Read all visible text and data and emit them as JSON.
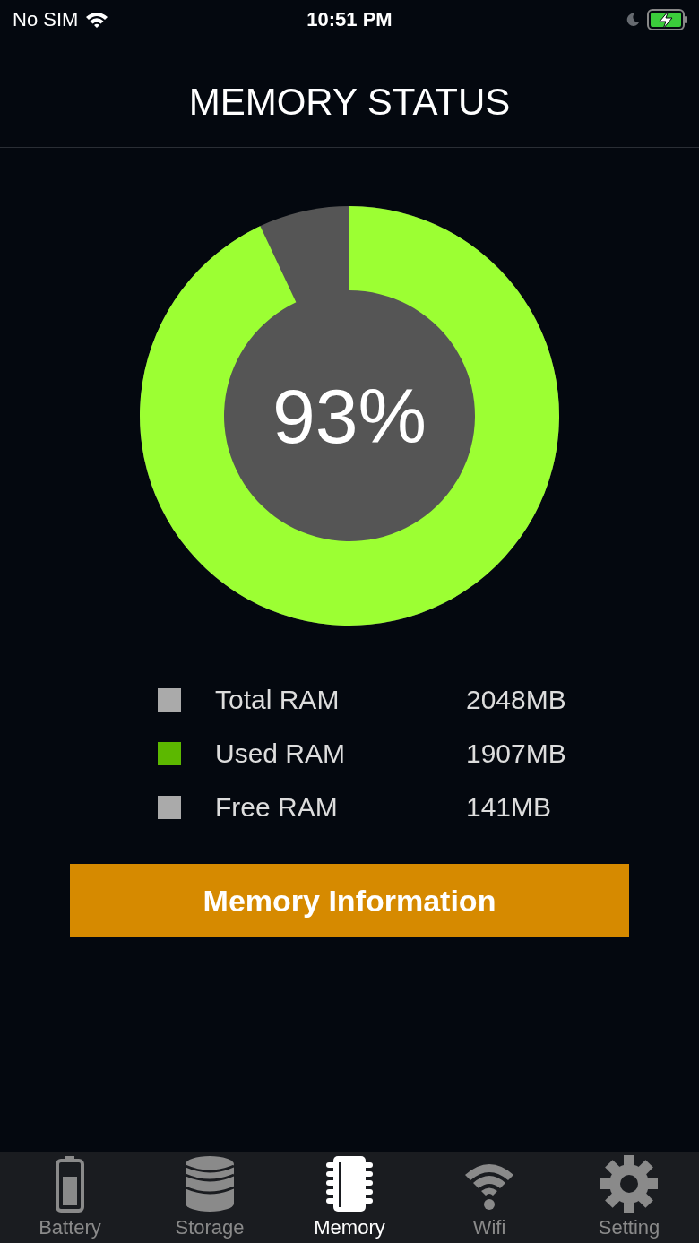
{
  "status_bar": {
    "carrier": "No SIM",
    "time": "10:51 PM"
  },
  "header": {
    "title": "MEMORY STATUS"
  },
  "memory_chart": {
    "center_label": "93%",
    "level": 0.93
  },
  "legend": [
    {
      "label": "Total RAM",
      "value": "2048MB",
      "color": "#aaaaaa"
    },
    {
      "label": "Used RAM",
      "value": "1907MB",
      "color": "#5cb800"
    },
    {
      "label": "Free RAM",
      "value": "141MB",
      "color": "#aaaaaa"
    }
  ],
  "action_button": {
    "label": "Memory Information"
  },
  "tabs": [
    {
      "label": "Battery",
      "kind": "battery",
      "selected": false
    },
    {
      "label": "Storage",
      "kind": "storage",
      "selected": false
    },
    {
      "label": "Memory",
      "kind": "memory",
      "selected": true
    },
    {
      "label": "Wifi",
      "kind": "wifi",
      "selected": false
    },
    {
      "label": "Setting",
      "kind": "setting",
      "selected": false
    }
  ]
}
